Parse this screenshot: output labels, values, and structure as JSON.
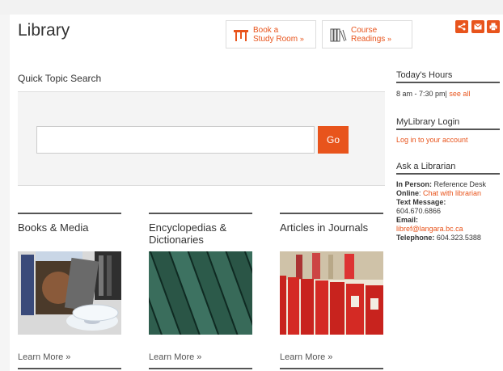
{
  "header": {
    "title": "Library",
    "book_room": {
      "line1": "Book a",
      "line2": "Study Room",
      "arrow": "»",
      "icon": "table-icon"
    },
    "course": {
      "line1": "Course",
      "line2": "Readings",
      "arrow": "»",
      "icon": "books-icon"
    },
    "share_icons": [
      "share-icon",
      "email-icon",
      "print-icon"
    ]
  },
  "search": {
    "label": "Quick Topic Search",
    "value": "",
    "go_label": "Go"
  },
  "sidebar": {
    "hours": {
      "heading": "Today's Hours",
      "text": "8 am - 7:30 pm|",
      "link": "see all"
    },
    "login": {
      "heading": "MyLibrary Login",
      "link": "Log in to your account"
    },
    "ask": {
      "heading": "Ask a Librarian",
      "in_person_label": "In Person:",
      "in_person_value": "Reference Desk",
      "online_label": "Online",
      "online_link": "Chat with librarian",
      "text_label": "Text Message:",
      "text_value": "604.670.6866",
      "email_label": "Email:",
      "email_value": "libref@langara.bc.ca",
      "phone_label": "Telephone:",
      "phone_value": "604.323.5388"
    }
  },
  "cards": [
    {
      "title": "Books & Media",
      "learn_more": "Learn More »",
      "image": "dvd-books-image"
    },
    {
      "title": "Encyclopedias & Dictionaries",
      "learn_more": "Learn More »",
      "image": "encyclopedia-spines-image"
    },
    {
      "title": "Articles in Journals",
      "learn_more": "Learn More »",
      "image": "journal-binders-image"
    }
  ],
  "colors": {
    "accent": "#e8541c",
    "text": "#333333",
    "panel": "#f4f4f4"
  }
}
